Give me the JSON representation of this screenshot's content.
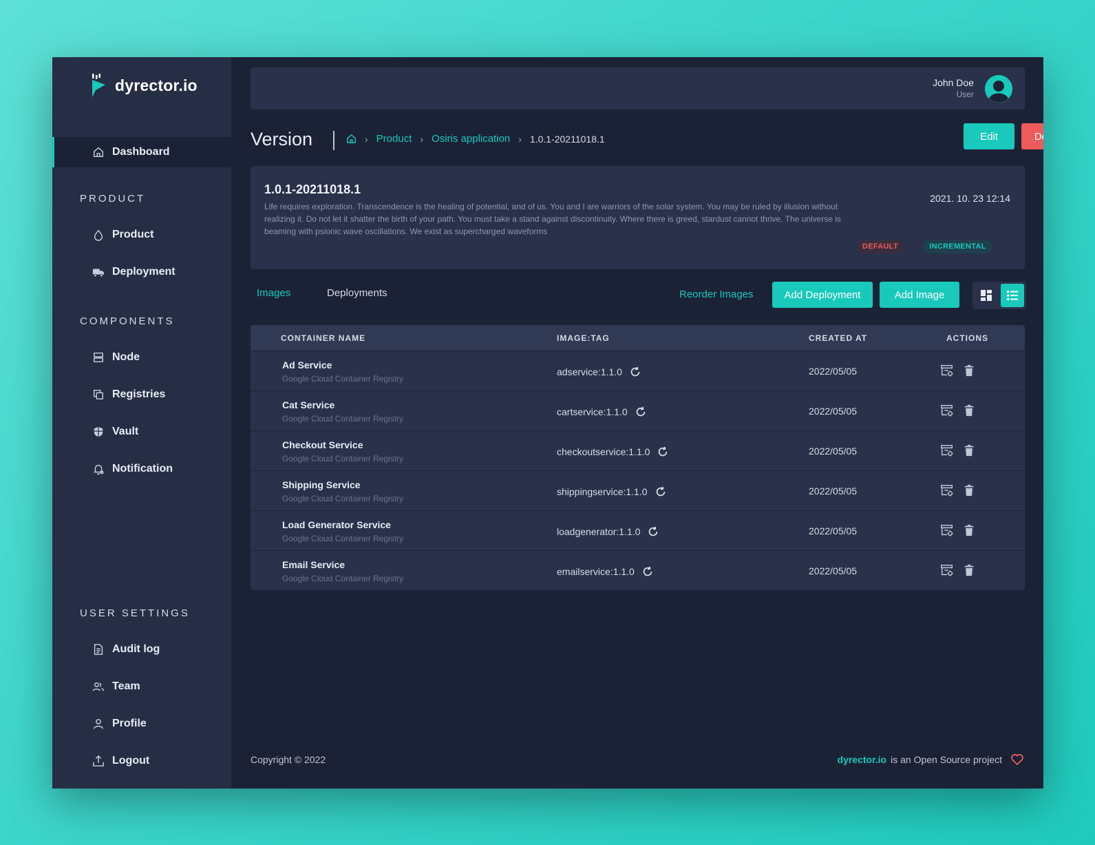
{
  "brand": {
    "name": "dyrector.io"
  },
  "sidebar": {
    "dashboard": {
      "label": "Dashboard",
      "icon": "home-icon"
    },
    "sections": {
      "product": "PRODUCT",
      "components": "COMPONENTS",
      "user_settings": "USER SETTINGS"
    },
    "product_items": [
      {
        "label": "Product",
        "icon": "droplet-icon"
      },
      {
        "label": "Deployment",
        "icon": "truck-icon"
      }
    ],
    "component_items": [
      {
        "label": "Node",
        "icon": "server-icon"
      },
      {
        "label": "Registries",
        "icon": "copy-icon"
      },
      {
        "label": "Vault",
        "icon": "shield-icon"
      },
      {
        "label": "Notification",
        "icon": "bell-icon"
      }
    ],
    "settings_items": [
      {
        "label": "Audit log",
        "icon": "document-icon"
      },
      {
        "label": "Team",
        "icon": "users-icon"
      },
      {
        "label": "Profile",
        "icon": "user-icon"
      },
      {
        "label": "Logout",
        "icon": "upload-icon"
      }
    ]
  },
  "header": {
    "user_name": "John Doe",
    "user_role": "User"
  },
  "page": {
    "title": "Version",
    "breadcrumb": [
      "Product",
      "Osiris application",
      "1.0.1-20211018.1"
    ],
    "edit_label": "Edit",
    "delete_label": "Delete"
  },
  "version": {
    "name": "1.0.1-20211018.1",
    "description": "Life requires exploration. Transcendence is the healing of potential, and of us. You and I are warriors of the solar system. You may be ruled by illusion without realizing it. Do not let it shatter the birth of your path. You must take a stand against discontinuity. Where there is greed, stardust cannot thrive. The universe is beaming with psionic wave oscillations. We exist as supercharged waveforms",
    "date": "2021. 10. 23 12:14",
    "badges": {
      "default": "DEFAULT",
      "incremental": "INCREMENTAL"
    }
  },
  "tabs": {
    "images": "Images",
    "deployments": "Deployments"
  },
  "toolbar": {
    "reorder": "Reorder Images",
    "add_deployment": "Add Deployment",
    "add_image": "Add Image"
  },
  "table": {
    "headers": [
      "CONTAINER NAME",
      "IMAGE:TAG",
      "CREATED AT",
      "ACTIONS"
    ],
    "rows": [
      {
        "name": "Ad Service",
        "registry": "Google Cloud Container Registry",
        "tag": "adservice:1.1.0",
        "created": "2022/05/05"
      },
      {
        "name": "Cat Service",
        "registry": "Google Cloud Container Registry",
        "tag": "cartservice:1.1.0",
        "created": "2022/05/05"
      },
      {
        "name": "Checkout Service",
        "registry": "Google Cloud Container Registry",
        "tag": "checkoutservice:1.1.0",
        "created": "2022/05/05"
      },
      {
        "name": "Shipping Service",
        "registry": "Google Cloud Container Registry",
        "tag": "shippingservice:1.1.0",
        "created": "2022/05/05"
      },
      {
        "name": "Load Generator Service",
        "registry": "Google Cloud Container Registry",
        "tag": "loadgenerator:1.1.0",
        "created": "2022/05/05"
      },
      {
        "name": "Email Service",
        "registry": "Google Cloud Container Registry",
        "tag": "emailservice:1.1.0",
        "created": "2022/05/05"
      }
    ]
  },
  "footer": {
    "copyright": "Copyright © 2022",
    "brand": "dyrector.io",
    "text": "is an Open Source project"
  },
  "colors": {
    "accent": "#19c9bb",
    "danger": "#ef5a5a",
    "sidebar": "#252e45",
    "background": "#1b2236",
    "card": "#29324a"
  }
}
